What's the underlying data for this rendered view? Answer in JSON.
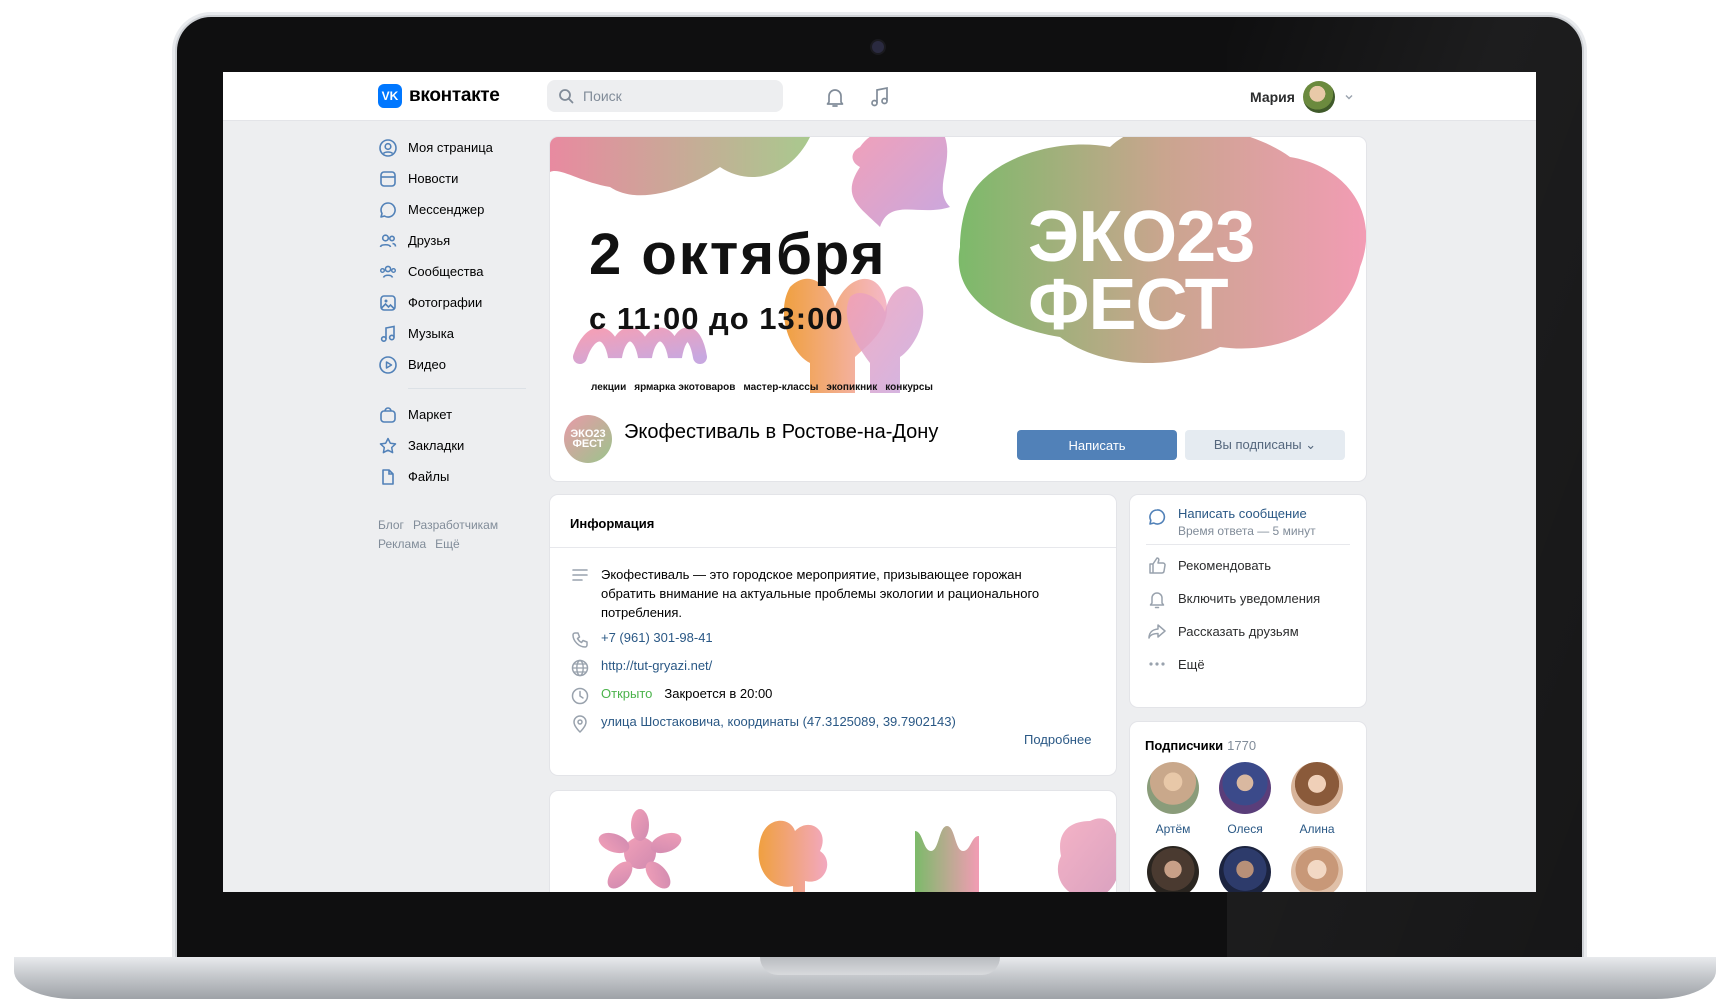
{
  "header": {
    "logo_text": "вконтакте",
    "logo_mark": "VK",
    "search_placeholder": "Поиск",
    "user_name": "Мария",
    "icons": [
      "search-icon",
      "bell-icon",
      "music-icon",
      "chevron-down-icon"
    ]
  },
  "sidebar": {
    "items": [
      {
        "label": "Моя страница",
        "icon": "profile-icon"
      },
      {
        "label": "Новости",
        "icon": "news-icon"
      },
      {
        "label": "Мессенджер",
        "icon": "messenger-icon"
      },
      {
        "label": "Друзья",
        "icon": "friends-icon"
      },
      {
        "label": "Сообщества",
        "icon": "communities-icon"
      },
      {
        "label": "Фотографии",
        "icon": "photos-icon"
      },
      {
        "label": "Музыка",
        "icon": "music-icon"
      },
      {
        "label": "Видео",
        "icon": "video-icon"
      }
    ],
    "items2": [
      {
        "label": "Маркет",
        "icon": "market-icon"
      },
      {
        "label": "Закладки",
        "icon": "bookmark-icon"
      },
      {
        "label": "Файлы",
        "icon": "files-icon"
      }
    ],
    "footer": [
      "Блог",
      "Разработчикам",
      "Реклама",
      "Ещё"
    ]
  },
  "cover": {
    "date": "2 октября",
    "time": "с 11:00 до 13:00",
    "tags": [
      "лекции",
      "ярмарка экотоваров",
      "мастер-классы",
      "экопикник",
      "конкурсы"
    ],
    "logo_line1": "ЭКО23",
    "logo_line2": "ФЕСТ"
  },
  "group": {
    "avatar_text": "ЭКО23 ФЕСТ",
    "name": "Экофестиваль в Ростове-на-Дону",
    "write_button": "Написать",
    "subscribed_button": "Вы подписаны"
  },
  "info": {
    "title": "Информация",
    "description": "Экофестиваль — это городское мероприятие, призывающее горожан обратить внимание на актуальные проблемы экологии и рационального потребления.",
    "phone": "+7 (961) 301-98-41",
    "website": "http://tut-gryazi.net/",
    "status_open": "Открыто",
    "closes": "Закроется в 20:00",
    "address": "улица Шостаковича, координаты (47.3125089, 39.7902143)",
    "more": "Подробнее"
  },
  "actions": {
    "write_message": "Написать сообщение",
    "response_time": "Время ответа — 5 минут",
    "recommend": "Рекомендовать",
    "notifications": "Включить уведомления",
    "share": "Рассказать друзьям",
    "more": "Ещё"
  },
  "subscribers": {
    "title": "Подписчики",
    "count": "1770",
    "people": [
      {
        "name": "Артём",
        "color": "#c9a88b"
      },
      {
        "name": "Олеся",
        "color": "#3b4a8a"
      },
      {
        "name": "Алина",
        "color": "#d8b49a"
      },
      {
        "name": "",
        "color": "#4a3a30"
      },
      {
        "name": "",
        "color": "#2d3b6b"
      },
      {
        "name": "",
        "color": "#e0c0a8"
      }
    ]
  },
  "colors": {
    "accent": "#5181b8",
    "link": "#2a5885",
    "open_green": "#4bb34b",
    "background": "#edeef0"
  }
}
